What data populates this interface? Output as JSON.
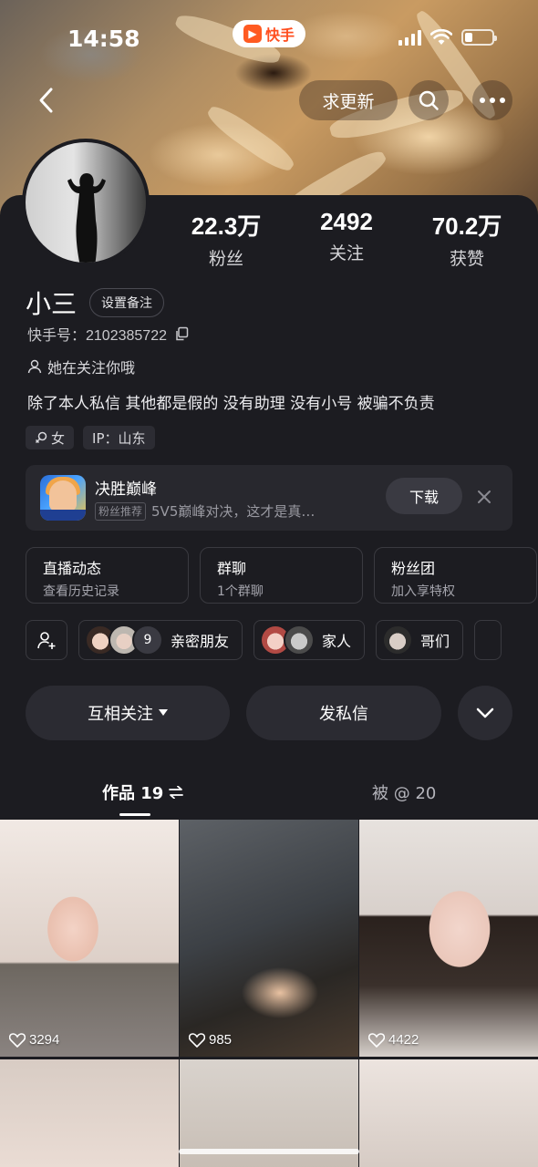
{
  "status": {
    "time": "14:58",
    "app_pill": "快手"
  },
  "nav": {
    "update_label": "求更新"
  },
  "profile": {
    "stats": [
      {
        "value": "22.3万",
        "label": "粉丝"
      },
      {
        "value": "2492",
        "label": "关注"
      },
      {
        "value": "70.2万",
        "label": "获赞"
      }
    ],
    "name": "小三",
    "remark_label": "设置备注",
    "kuaishou_id": "快手号：2102385722",
    "follows_you": "她在关注你哦",
    "bio": "除了本人私信 其他都是假的 没有助理 没有小号 被骗不负责",
    "tags": [
      {
        "label": "女",
        "icon": "female-icon"
      },
      {
        "label": "IP：山东"
      }
    ]
  },
  "promo": {
    "title": "决胜巅峰",
    "badge": "粉丝推荐",
    "subtitle": "5V5巅峰对决，这才是真…",
    "download_label": "下载"
  },
  "cards": [
    {
      "title": "直播动态",
      "sub": "查看历史记录"
    },
    {
      "title": "群聊",
      "sub": "1个群聊"
    },
    {
      "title": "粉丝团",
      "sub": "加入享特权"
    }
  ],
  "groups": [
    {
      "label": "亲密朋友",
      "count": "9"
    },
    {
      "label": "家人"
    },
    {
      "label": "哥们"
    }
  ],
  "actions": {
    "follow_label": "互相关注",
    "message_label": "发私信"
  },
  "tabs": {
    "works_label": "作品 19",
    "at_label": "被 @ 20"
  },
  "videos": [
    {
      "likes": "3294"
    },
    {
      "likes": "985"
    },
    {
      "likes": "4422"
    }
  ]
}
